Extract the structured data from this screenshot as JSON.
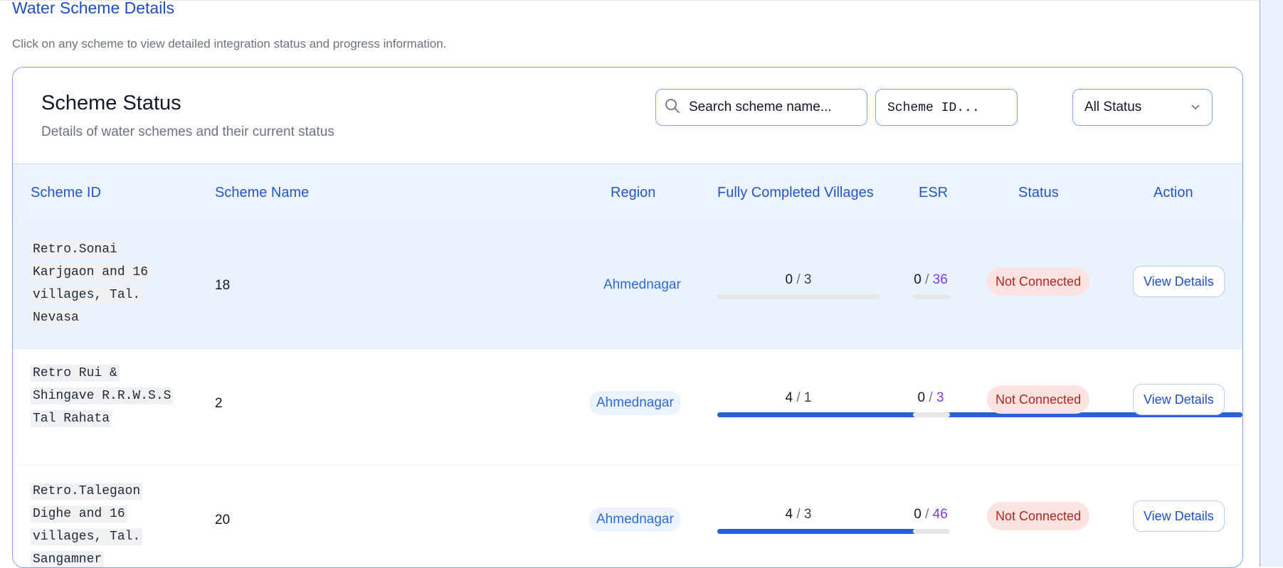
{
  "page": {
    "title": "Water Scheme Details",
    "description": "Click on any scheme to view detailed integration status and progress information."
  },
  "card": {
    "title": "Scheme Status",
    "subtitle": "Details of water schemes and their current status"
  },
  "filters": {
    "search_placeholder": "Search scheme name...",
    "scheme_id_placeholder": "Scheme ID...",
    "status_value": "All Status"
  },
  "icons": {
    "search": "search-icon",
    "dropdown": "chevron-down-icon"
  },
  "colors": {
    "accent": "#2356c9",
    "progress": "#2463d6",
    "badge_bg": "#fde2e2",
    "badge_text": "#b3261e",
    "esr_total": "#7c3aed"
  },
  "table": {
    "headers": {
      "scheme_id": "Scheme ID",
      "scheme_name": "Scheme Name",
      "region": "Region",
      "villages": "Fully Completed Villages",
      "esr": "ESR",
      "status": "Status",
      "action": "Action"
    },
    "rows": [
      {
        "scheme_id_lines": [
          " Retro.Sonai",
          "Karjgaon and 16",
          "villages, Tal.",
          "Nevasa"
        ],
        "scheme_name": "18",
        "region": "Ahmednagar",
        "villages_done": "0",
        "villages_total": "3",
        "villages_progress": 0,
        "esr_done": "0",
        "esr_total": "36",
        "esr_progress": 0,
        "status": "Not Connected",
        "action": "View Details"
      },
      {
        "scheme_id_lines": [
          " Retro Rui &",
          "Shingave R.R.W.S.S",
          "Tal Rahata"
        ],
        "scheme_name": "2",
        "region": "Ahmednagar",
        "villages_done": "4",
        "villages_total": "1",
        "villages_progress": 4,
        "esr_done": "0",
        "esr_total": "3",
        "esr_progress": 0,
        "status": "Not Connected",
        "action": "View Details"
      },
      {
        "scheme_id_lines": [
          " Retro.Talegaon",
          "Dighe and 16",
          "villages, Tal.",
          "Sangamner"
        ],
        "scheme_name": "20",
        "region": "Ahmednagar",
        "villages_done": "4",
        "villages_total": "3",
        "villages_progress": 1.33,
        "esr_done": "0",
        "esr_total": "46",
        "esr_progress": 0,
        "status": "Not Connected",
        "action": "View Details"
      }
    ]
  }
}
